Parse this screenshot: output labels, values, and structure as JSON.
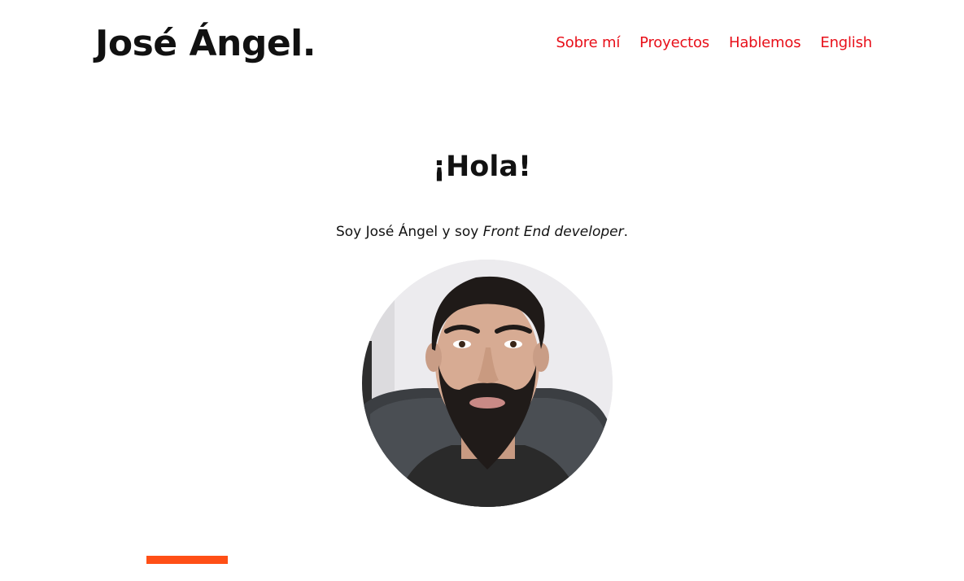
{
  "header": {
    "brand": "José Ángel.",
    "nav": [
      {
        "label": "Sobre mí"
      },
      {
        "label": "Proyectos"
      },
      {
        "label": "Hablemos"
      },
      {
        "label": "English"
      }
    ]
  },
  "hero": {
    "title": "¡Hola!",
    "intro_prefix": "Soy José Ángel y soy ",
    "intro_role": "Front End developer",
    "intro_suffix": "."
  },
  "colors": {
    "accent": "#e8101a",
    "bar": "#ff4f16",
    "text": "#111111"
  }
}
